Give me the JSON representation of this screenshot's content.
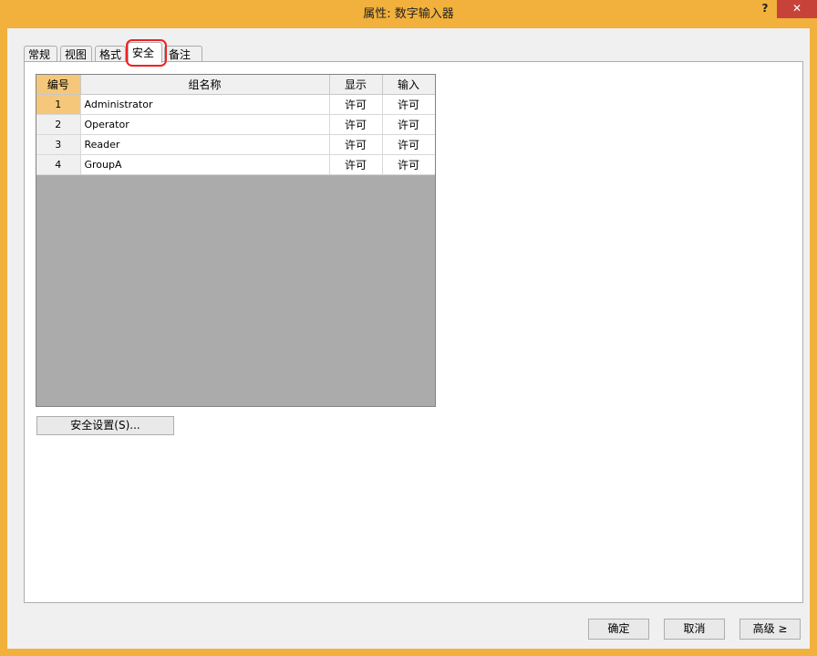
{
  "window": {
    "title": "属性: 数字输入器",
    "help_label": "?",
    "close_label": "✕"
  },
  "tabs": [
    {
      "label": "常规",
      "active": false
    },
    {
      "label": "视图",
      "active": false
    },
    {
      "label": "格式",
      "active": false
    },
    {
      "label": "安全",
      "active": true
    },
    {
      "label": "备注",
      "active": false
    }
  ],
  "table": {
    "columns": [
      "编号",
      "组名称",
      "显示",
      "输入"
    ],
    "rows": [
      {
        "id": "1",
        "name": "Administrator",
        "display": "许可",
        "input": "许可"
      },
      {
        "id": "2",
        "name": "Operator",
        "display": "许可",
        "input": "许可"
      },
      {
        "id": "3",
        "name": "Reader",
        "display": "许可",
        "input": "许可"
      },
      {
        "id": "4",
        "name": "GroupA",
        "display": "许可",
        "input": "许可"
      }
    ]
  },
  "security_button_label": "安全设置(S)...",
  "footer": {
    "ok_label": "确定",
    "cancel_label": "取消",
    "advanced_label": "高级 ≥"
  }
}
